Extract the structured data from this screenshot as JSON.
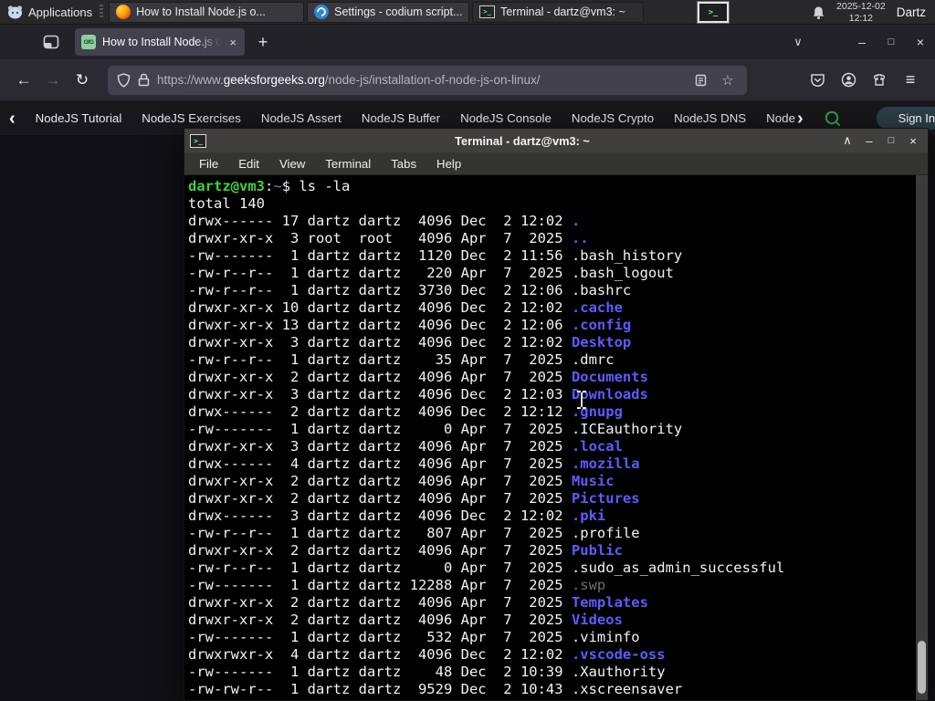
{
  "glyphs": {
    "back": "←",
    "forward": "→",
    "reload": "↻",
    "menu": "≡",
    "new_tab": "+",
    "list_tabs": "∨",
    "close": "×",
    "minimize": "–",
    "maximize": "□",
    "shade": "∧",
    "star": "☆",
    "chevron_left": "‹",
    "chevron_right": "›",
    "terminal_glyph": ">_"
  },
  "taskbar": {
    "applications": {
      "label": "Applications",
      "icon": "xfce-logo"
    },
    "windows": [
      {
        "title": "How to Install Node.js o...",
        "icon": "firefox",
        "active": false
      },
      {
        "title": "Settings - codium script...",
        "icon": "vscodium",
        "active": false
      },
      {
        "title": "Terminal - dartz@vm3: ~",
        "icon": "terminal",
        "active": true
      }
    ],
    "tray": {
      "icon": "terminal-icon"
    },
    "clock": {
      "date": "2025-12-02",
      "time": "12:12"
    },
    "user": "Dartz"
  },
  "browser": {
    "tab_title": "How to Install Node.js on",
    "urlbar": {
      "prefix": "https://www.",
      "domain": "geeksforgeeks.org",
      "path": "/node-js/installation-of-node-js-on-linux/"
    },
    "favicon_text": "GfG"
  },
  "gfg": {
    "nav_items": [
      "NodeJS Tutorial",
      "NodeJS Exercises",
      "NodeJS Assert",
      "NodeJS Buffer",
      "NodeJS Console",
      "NodeJS Crypto",
      "NodeJS DNS"
    ],
    "nav_last_item": "Node",
    "sign_in": "Sign In"
  },
  "terminal": {
    "title": "Terminal - dartz@vm3: ~",
    "menu": [
      "File",
      "Edit",
      "View",
      "Terminal",
      "Tabs",
      "Help"
    ],
    "prompt": {
      "user_host": "dartz@vm3",
      "colon": ":",
      "cwd": "~",
      "dollar": "$ ",
      "command": "ls -la"
    },
    "total": "total 140",
    "listing": [
      {
        "pre": "drwx------ 17 dartz dartz  4096 Dec  2 12:02 ",
        "name": ".",
        "type": "dir"
      },
      {
        "pre": "drwxr-xr-x  3 root  root   4096 Apr  7  2025 ",
        "name": "..",
        "type": "dir"
      },
      {
        "pre": "-rw-------  1 dartz dartz  1120 Dec  2 11:56 ",
        "name": ".bash_history",
        "type": "file"
      },
      {
        "pre": "-rw-r--r--  1 dartz dartz   220 Apr  7  2025 ",
        "name": ".bash_logout",
        "type": "file"
      },
      {
        "pre": "-rw-r--r--  1 dartz dartz  3730 Dec  2 12:06 ",
        "name": ".bashrc",
        "type": "file"
      },
      {
        "pre": "drwxr-xr-x 10 dartz dartz  4096 Dec  2 12:02 ",
        "name": ".cache",
        "type": "dir"
      },
      {
        "pre": "drwxr-xr-x 13 dartz dartz  4096 Dec  2 12:06 ",
        "name": ".config",
        "type": "dir"
      },
      {
        "pre": "drwxr-xr-x  3 dartz dartz  4096 Dec  2 12:02 ",
        "name": "Desktop",
        "type": "dir"
      },
      {
        "pre": "-rw-r--r--  1 dartz dartz    35 Apr  7  2025 ",
        "name": ".dmrc",
        "type": "file"
      },
      {
        "pre": "drwxr-xr-x  2 dartz dartz  4096 Apr  7  2025 ",
        "name": "Documents",
        "type": "dir"
      },
      {
        "pre": "drwxr-xr-x  3 dartz dartz  4096 Dec  2 12:03 ",
        "name": "Downloads",
        "type": "dir"
      },
      {
        "pre": "drwx------  2 dartz dartz  4096 Dec  2 12:12 ",
        "name": ".gnupg",
        "type": "dir"
      },
      {
        "pre": "-rw-------  1 dartz dartz     0 Apr  7  2025 ",
        "name": ".ICEauthority",
        "type": "file"
      },
      {
        "pre": "drwxr-xr-x  3 dartz dartz  4096 Apr  7  2025 ",
        "name": ".local",
        "type": "dir"
      },
      {
        "pre": "drwx------  4 dartz dartz  4096 Apr  7  2025 ",
        "name": ".mozilla",
        "type": "dir"
      },
      {
        "pre": "drwxr-xr-x  2 dartz dartz  4096 Apr  7  2025 ",
        "name": "Music",
        "type": "dir"
      },
      {
        "pre": "drwxr-xr-x  2 dartz dartz  4096 Apr  7  2025 ",
        "name": "Pictures",
        "type": "dir"
      },
      {
        "pre": "drwx------  3 dartz dartz  4096 Dec  2 12:02 ",
        "name": ".pki",
        "type": "dir"
      },
      {
        "pre": "-rw-r--r--  1 dartz dartz   807 Apr  7  2025 ",
        "name": ".profile",
        "type": "file"
      },
      {
        "pre": "drwxr-xr-x  2 dartz dartz  4096 Apr  7  2025 ",
        "name": "Public",
        "type": "dir"
      },
      {
        "pre": "-rw-r--r--  1 dartz dartz     0 Apr  7  2025 ",
        "name": ".sudo_as_admin_successful",
        "type": "file"
      },
      {
        "pre": "-rw-------  1 dartz dartz 12288 Apr  7  2025 ",
        "name": ".swp",
        "type": "dim"
      },
      {
        "pre": "drwxr-xr-x  2 dartz dartz  4096 Apr  7  2025 ",
        "name": "Templates",
        "type": "dir"
      },
      {
        "pre": "drwxr-xr-x  2 dartz dartz  4096 Apr  7  2025 ",
        "name": "Videos",
        "type": "dir"
      },
      {
        "pre": "-rw-------  1 dartz dartz   532 Apr  7  2025 ",
        "name": ".viminfo",
        "type": "file"
      },
      {
        "pre": "drwxrwxr-x  4 dartz dartz  4096 Dec  2 12:02 ",
        "name": ".vscode-oss",
        "type": "dir"
      },
      {
        "pre": "-rw-------  1 dartz dartz    48 Dec  2 10:39 ",
        "name": ".Xauthority",
        "type": "file"
      },
      {
        "pre": "-rw-rw-r--  1 dartz dartz  9529 Dec  2 10:43 ",
        "name": ".xscreensaver",
        "type": "file"
      }
    ]
  },
  "colors": {
    "taskbar_bg": "#28282b",
    "tab_active_bg": "#42414d",
    "toolbar_bg": "#2b2a33",
    "gfg_nav_bg": "#17171c",
    "gfg_green": "#2f9e49",
    "terminal_bg": "#000000",
    "prompt_green": "#3fd23f",
    "dir_blue": "#5c5cff",
    "titlebar_gray": "#403f3b"
  }
}
